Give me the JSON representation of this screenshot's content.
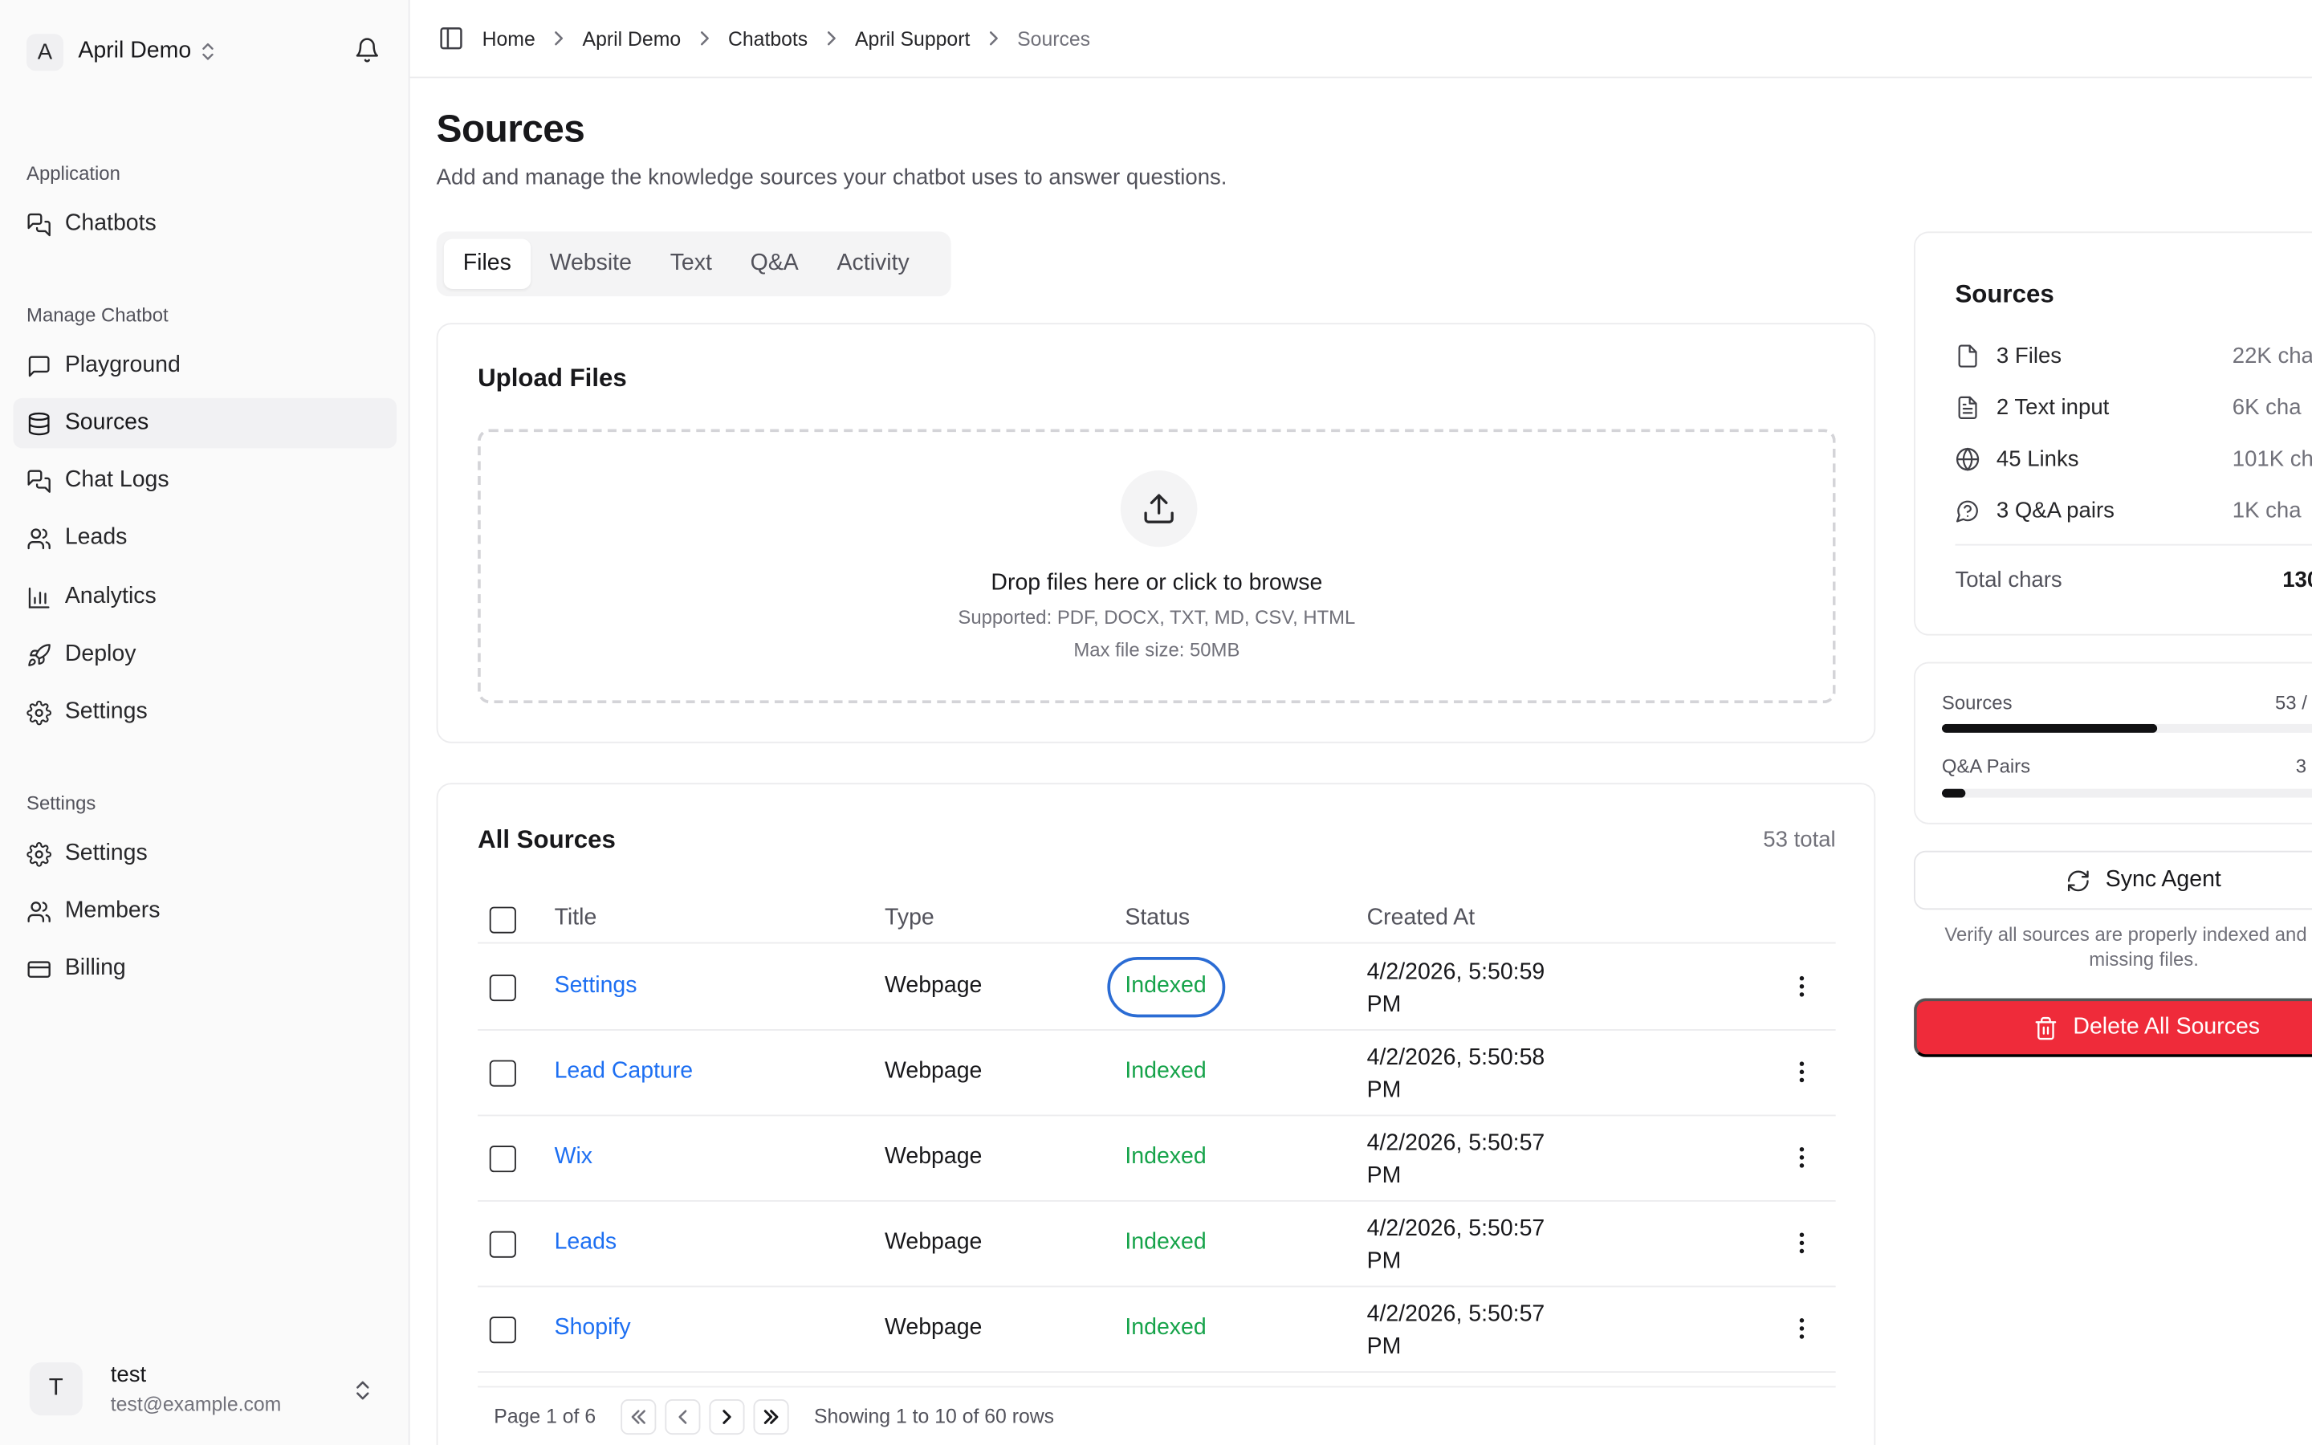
{
  "workspace": {
    "initial": "A",
    "name": "April Demo"
  },
  "sidebar": {
    "sections": [
      {
        "label": "Application"
      },
      {
        "label": "Manage Chatbot"
      },
      {
        "label": "Settings"
      }
    ],
    "items": [
      {
        "label": "Chatbots",
        "icon": "chat-bubbles-icon"
      },
      {
        "label": "Playground",
        "icon": "message-square-icon"
      },
      {
        "label": "Sources",
        "icon": "database-icon",
        "active": true
      },
      {
        "label": "Chat Logs",
        "icon": "chat-bubbles-icon"
      },
      {
        "label": "Leads",
        "icon": "users-icon"
      },
      {
        "label": "Analytics",
        "icon": "bar-chart-icon"
      },
      {
        "label": "Deploy",
        "icon": "rocket-icon"
      },
      {
        "label": "Settings",
        "icon": "gear-icon"
      },
      {
        "label": "Settings",
        "icon": "gear-icon"
      },
      {
        "label": "Members",
        "icon": "users-icon"
      },
      {
        "label": "Billing",
        "icon": "credit-card-icon"
      }
    ]
  },
  "user": {
    "initial": "T",
    "name": "test",
    "email": "test@example.com"
  },
  "breadcrumb": [
    "Home",
    "April Demo",
    "Chatbots",
    "April Support",
    "Sources"
  ],
  "page": {
    "title": "Sources",
    "subtitle": "Add and manage the knowledge sources your chatbot uses to answer questions."
  },
  "tabs": [
    {
      "label": "Files",
      "active": true
    },
    {
      "label": "Website"
    },
    {
      "label": "Text"
    },
    {
      "label": "Q&A"
    },
    {
      "label": "Activity"
    }
  ],
  "upload": {
    "title": "Upload Files",
    "drop_title": "Drop files here or click to browse",
    "supported": "Supported: PDF, DOCX, TXT, MD, CSV, HTML",
    "max_size": "Max file size: 50MB"
  },
  "sources_table": {
    "title": "All Sources",
    "total": "53 total",
    "columns": [
      "Title",
      "Type",
      "Status",
      "Created At"
    ],
    "rows": [
      {
        "title": "Settings",
        "type": "Webpage",
        "status": "Indexed",
        "date_line1": "4/2/2026, 5:50:59",
        "date_line2": "PM"
      },
      {
        "title": "Lead Capture",
        "type": "Webpage",
        "status": "Indexed",
        "date_line1": "4/2/2026, 5:50:58",
        "date_line2": "PM"
      },
      {
        "title": "Wix",
        "type": "Webpage",
        "status": "Indexed",
        "date_line1": "4/2/2026, 5:50:57",
        "date_line2": "PM"
      },
      {
        "title": "Leads",
        "type": "Webpage",
        "status": "Indexed",
        "date_line1": "4/2/2026, 5:50:57",
        "date_line2": "PM"
      },
      {
        "title": "Shopify",
        "type": "Webpage",
        "status": "Indexed",
        "date_line1": "4/2/2026, 5:50:57",
        "date_line2": "PM"
      }
    ],
    "pager": {
      "page": "Page 1 of 6",
      "showing": "Showing 1 to 10 of 60 rows"
    }
  },
  "stats": {
    "title": "Sources",
    "items": [
      {
        "label": "3 Files",
        "value": "22K cha",
        "icon": "file-icon"
      },
      {
        "label": "2 Text input",
        "value": "6K cha",
        "icon": "file-text-icon"
      },
      {
        "label": "45 Links",
        "value": "101K cha",
        "icon": "globe-icon"
      },
      {
        "label": "3 Q&A pairs",
        "value": "1K cha",
        "icon": "help-circle-icon"
      }
    ],
    "total_label": "Total chars",
    "total_value": "130"
  },
  "limits": [
    {
      "label": "Sources",
      "value": "53 /",
      "fill": 0.54
    },
    {
      "label": "Q&A Pairs",
      "value": "3",
      "fill": 0.06
    }
  ],
  "actions": {
    "sync_label": "Sync Agent",
    "sync_note": "Verify all sources are properly indexed and any missing files.",
    "delete_label": "Delete All Sources"
  },
  "colors": {
    "link": "#1d6ff2",
    "indexed": "#16a34a",
    "danger": "#ef2b3a",
    "focus_ring": "#2b6cd4"
  }
}
